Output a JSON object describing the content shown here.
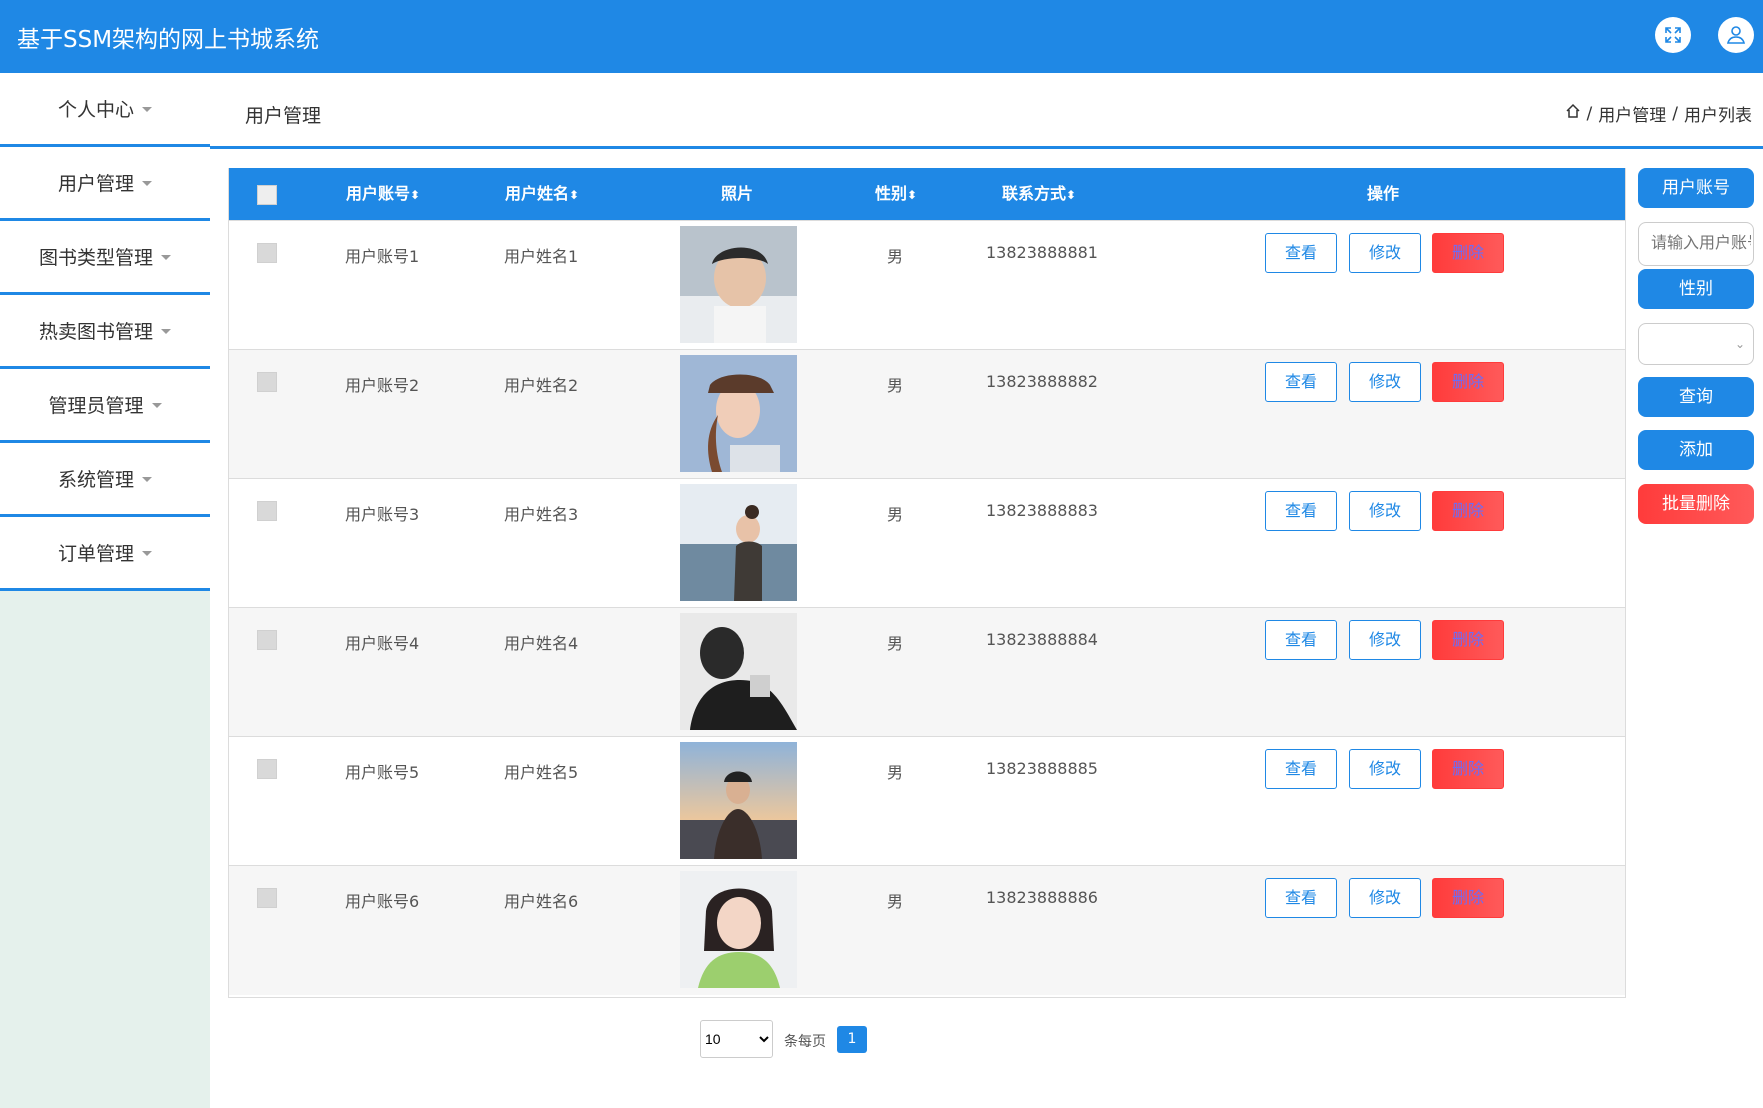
{
  "app": {
    "title": "基于SSM架构的网上书城系统"
  },
  "topbar": {
    "icons": [
      "fullscreen-icon",
      "user-icon"
    ]
  },
  "sidebar": {
    "items": [
      {
        "label": "个人中心"
      },
      {
        "label": "用户管理"
      },
      {
        "label": "图书类型管理"
      },
      {
        "label": "热卖图书管理"
      },
      {
        "label": "管理员管理"
      },
      {
        "label": "系统管理"
      },
      {
        "label": "订单管理"
      }
    ]
  },
  "header": {
    "title": "用户管理",
    "breadcrumb": [
      "用户管理",
      "用户列表"
    ],
    "breadcrumb_sep": "/"
  },
  "table": {
    "columns": [
      "用户账号",
      "用户姓名",
      "照片",
      "性别",
      "联系方式",
      "操作"
    ],
    "sort_glyph": "⬍",
    "rows": [
      {
        "account": "用户账号1",
        "name": "用户姓名1",
        "gender": "男",
        "phone": "13823888881"
      },
      {
        "account": "用户账号2",
        "name": "用户姓名2",
        "gender": "男",
        "phone": "13823888882"
      },
      {
        "account": "用户账号3",
        "name": "用户姓名3",
        "gender": "男",
        "phone": "13823888883"
      },
      {
        "account": "用户账号4",
        "name": "用户姓名4",
        "gender": "男",
        "phone": "13823888884"
      },
      {
        "account": "用户账号5",
        "name": "用户姓名5",
        "gender": "男",
        "phone": "13823888885"
      },
      {
        "account": "用户账号6",
        "name": "用户姓名6",
        "gender": "男",
        "phone": "13823888886"
      }
    ],
    "actions": {
      "view": "查看",
      "edit": "修改",
      "delete": "删除"
    }
  },
  "search_panel": {
    "account_label": "用户账号",
    "account_placeholder": "请输入用户账号",
    "gender_label": "性别",
    "gender_value": "",
    "query_button": "查询",
    "add_button": "添加",
    "batch_delete_button": "批量删除"
  },
  "pagination": {
    "page_size": "10",
    "page_size_options": [
      "10"
    ],
    "per_page_label": "条每页",
    "current_page": "1"
  },
  "colors": {
    "primary": "#1f88e5",
    "danger": "#ff3b3b",
    "sidebar_bg": "#e5f1ec"
  }
}
